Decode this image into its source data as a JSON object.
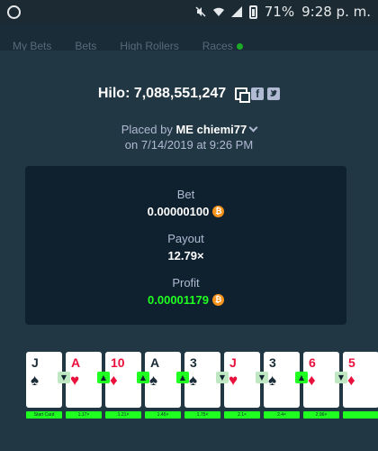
{
  "status_bar": {
    "battery_pct": "71%",
    "time": "9:28 p. m."
  },
  "tabs": [
    "My Bets",
    "Bets",
    "High Rollers",
    "Races"
  ],
  "bet": {
    "title": "Hilo: 7,088,551,247",
    "placed_by_prefix": "Placed by",
    "placed_by_badge": "ME",
    "placed_by_user": "chiemi77",
    "placed_on": "on 7/14/2019 at 9:26 PM"
  },
  "stats": {
    "bet_label": "Bet",
    "bet_value": "0.00000100",
    "payout_label": "Payout",
    "payout_value": "12.79×",
    "profit_label": "Profit",
    "profit_value": "0.00001179"
  },
  "cards": [
    {
      "rank": "J",
      "suit": "♠",
      "color": "black"
    },
    {
      "rank": "A",
      "suit": "♥",
      "color": "red"
    },
    {
      "rank": "10",
      "suit": "♦",
      "color": "red"
    },
    {
      "rank": "A",
      "suit": "♠",
      "color": "black"
    },
    {
      "rank": "3",
      "suit": "♠",
      "color": "black"
    },
    {
      "rank": "J",
      "suit": "♥",
      "color": "red"
    },
    {
      "rank": "3",
      "suit": "♠",
      "color": "black"
    },
    {
      "rank": "6",
      "suit": "♦",
      "color": "red"
    },
    {
      "rank": "5",
      "suit": "♦",
      "color": "red"
    }
  ],
  "arrows": [
    "down",
    "up",
    "up",
    "up",
    "down",
    "down",
    "up",
    "down"
  ],
  "multipliers": [
    "Start Card",
    "1.17×",
    "1.21×",
    "1.45×",
    "1.75×",
    "2.1×",
    "2.4×",
    "2.96×",
    ""
  ],
  "colors": {
    "accent_green": "#1fff20",
    "panel": "#213743",
    "dark_panel": "#0f212e",
    "bitcoin": "#f7931a",
    "card_red": "#e9113c"
  },
  "icons": [
    "whatsapp-icon",
    "mute-icon",
    "wifi-icon",
    "signal-icon",
    "battery-icon",
    "copy-icon",
    "facebook-icon",
    "twitter-icon",
    "chevron-down-icon",
    "bitcoin-icon",
    "arrow-icon"
  ]
}
